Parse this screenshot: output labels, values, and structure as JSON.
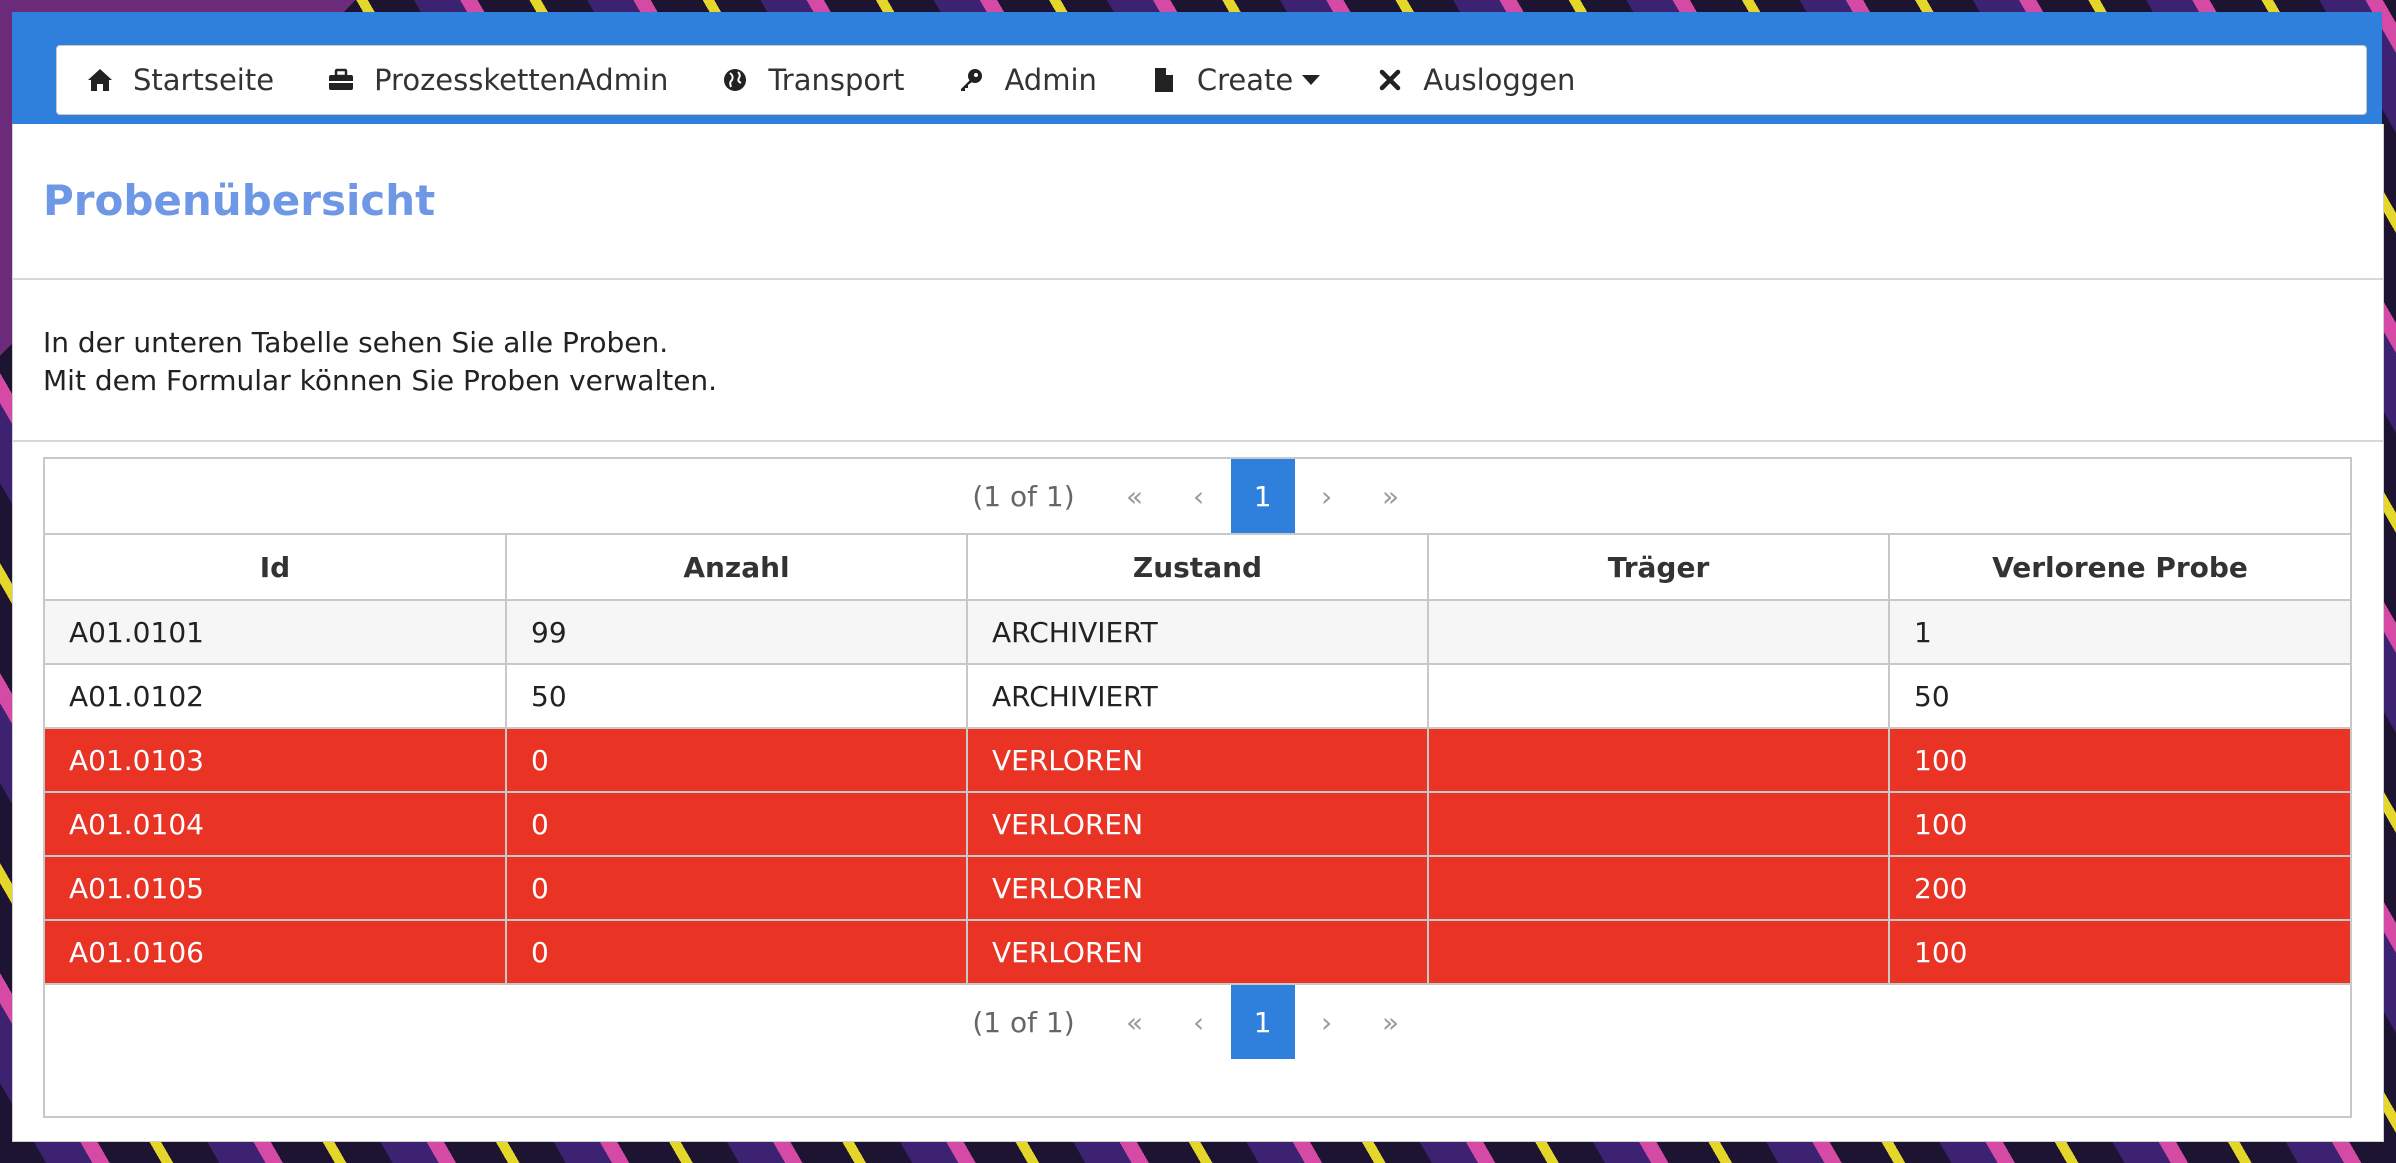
{
  "nav": {
    "items": [
      {
        "label": "Startseite",
        "icon": "home-icon"
      },
      {
        "label": "ProzesskettenAdmin",
        "icon": "briefcase-icon"
      },
      {
        "label": "Transport",
        "icon": "globe-icon"
      },
      {
        "label": "Admin",
        "icon": "key-icon"
      },
      {
        "label": "Create",
        "icon": "file-icon"
      },
      {
        "label": "Ausloggen",
        "icon": "close-icon"
      }
    ]
  },
  "page": {
    "title": "Probenübersicht",
    "intro_line1": "In der unteren Tabelle sehen Sie alle Proben.",
    "intro_line2": "Mit dem Formular können Sie Proben verwalten."
  },
  "paginator": {
    "info": "(1 of 1)",
    "current_page": "1"
  },
  "table": {
    "headers": [
      "Id",
      "Anzahl",
      "Zustand",
      "Träger",
      "Verlorene Probe"
    ],
    "rows": [
      {
        "id": "A01.0101",
        "anzahl": "99",
        "zustand": "ARCHIVIERT",
        "traeger": "",
        "verlorene": "1"
      },
      {
        "id": "A01.0102",
        "anzahl": "50",
        "zustand": "ARCHIVIERT",
        "traeger": "",
        "verlorene": "50"
      },
      {
        "id": "A01.0103",
        "anzahl": "0",
        "zustand": "VERLOREN",
        "traeger": "",
        "verlorene": "100"
      },
      {
        "id": "A01.0104",
        "anzahl": "0",
        "zustand": "VERLOREN",
        "traeger": "",
        "verlorene": "100"
      },
      {
        "id": "A01.0105",
        "anzahl": "0",
        "zustand": "VERLOREN",
        "traeger": "",
        "verlorene": "200"
      },
      {
        "id": "A01.0106",
        "anzahl": "0",
        "zustand": "VERLOREN",
        "traeger": "",
        "verlorene": "100"
      }
    ]
  },
  "colors": {
    "topbar": "#2f80dc",
    "title": "#6e97e6",
    "lost_row": "#e83325",
    "page_active": "#2f80dc"
  }
}
